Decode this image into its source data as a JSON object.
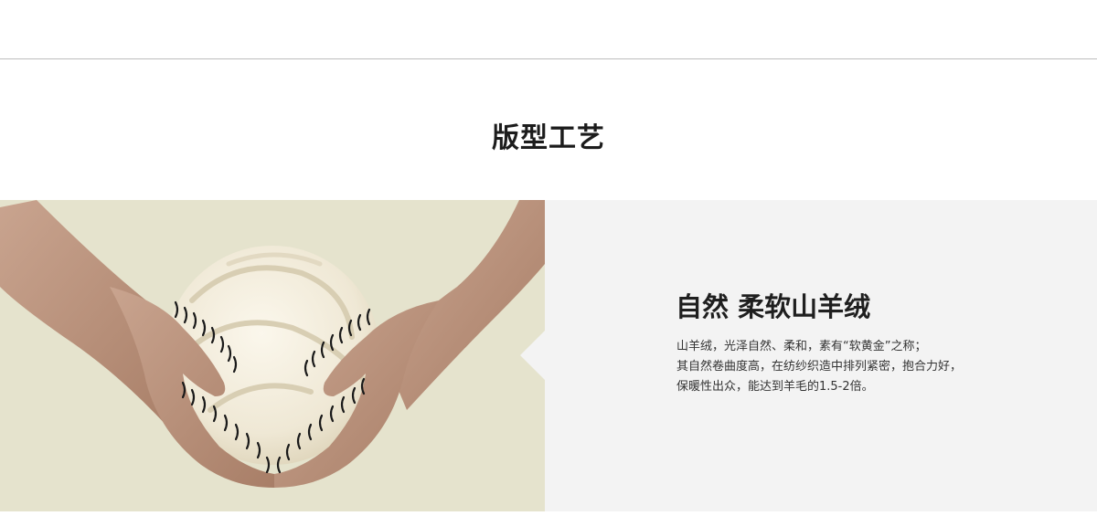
{
  "section": {
    "title": "版型工艺"
  },
  "image": {
    "description": "hands-holding-cashmere-ball"
  },
  "feature": {
    "heading": "自然 柔软山羊绒",
    "body_lines": [
      "山羊绒，光泽自然、柔和，素有“软黄金”之称；",
      "其自然卷曲度高，在纺纱织造中排列紧密，抱合力好，",
      "保暖性出众，能达到羊毛的1.5-2倍。"
    ]
  },
  "colors": {
    "image_bg": "#e5e3cd",
    "text_panel_bg": "#f3f3f3",
    "rule": "#bdbdbd",
    "heading": "#1f1f1f"
  }
}
